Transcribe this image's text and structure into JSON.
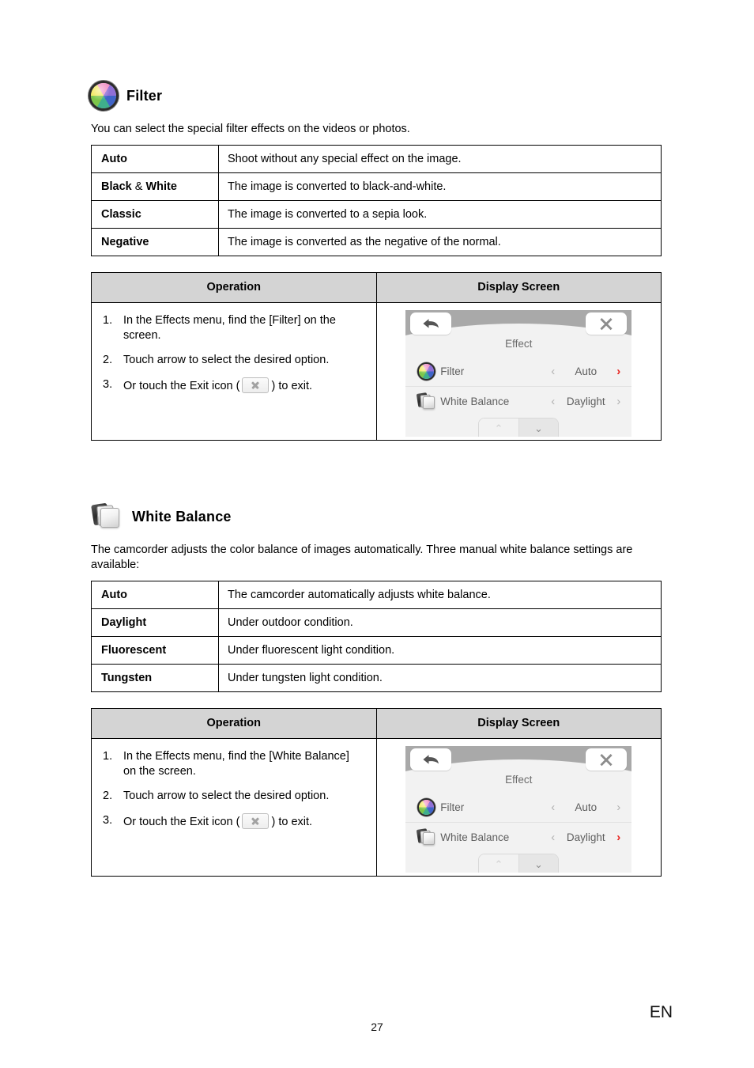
{
  "document": {
    "page_number": "27",
    "language_code": "EN"
  },
  "sections": [
    {
      "id": "filter",
      "icon": "color-wheel-icon",
      "title": "Filter",
      "intro": "You can select the special filter effects on the videos or photos.",
      "terms_table": {
        "rows": [
          {
            "term": "Auto",
            "term_bold_prefix": "Auto",
            "description": "Shoot without any special effect on the image."
          },
          {
            "term": "Black & White",
            "term_bold_prefix": "Black",
            "term_amp": "&",
            "term_bold_suffix": "White",
            "description": "The image is converted to black-and-white."
          },
          {
            "term": "Classic",
            "description": "The image is converted to a sepia look."
          },
          {
            "term": "Negative",
            "description": "The image is converted as the negative of the normal."
          }
        ]
      },
      "operation_table": {
        "headers": {
          "operation": "Operation",
          "display_screen": "Display Screen"
        },
        "steps": [
          {
            "num": "1.",
            "text": "In the Effects menu, find the [Filter] on the screen."
          },
          {
            "num": "2.",
            "text": "Touch arrow to select the desired option."
          },
          {
            "num": "3.",
            "text_before": "Or touch the Exit icon (",
            "icon": "exit-icon",
            "text_after": ") to exit."
          }
        ],
        "screen": {
          "back_icon": "back-arrow-icon",
          "close_icon": "close-x-icon",
          "title": "Effect",
          "rows": [
            {
              "icon": "color-wheel-icon",
              "label": "Filter",
              "left_chevron": "‹",
              "value": "Auto",
              "right_chevron": "›",
              "right_highlighted": true
            },
            {
              "icon": "card-stack-icon",
              "label": "White Balance",
              "left_chevron": "‹",
              "value": "Daylight",
              "right_chevron": "›",
              "right_highlighted": false
            }
          ],
          "pager": {
            "up": "⌃",
            "down": "⌄"
          }
        }
      }
    },
    {
      "id": "white-balance",
      "icon": "card-stack-icon",
      "title": "White Balance",
      "intro": "The camcorder adjusts the color balance of images automatically. Three manual white balance settings are available:",
      "terms_table": {
        "rows": [
          {
            "term": "Auto",
            "description": "The camcorder automatically adjusts white balance."
          },
          {
            "term": "Daylight",
            "description": "Under outdoor condition."
          },
          {
            "term": "Fluorescent",
            "description": "Under fluorescent light condition."
          },
          {
            "term": "Tungsten",
            "description": "Under tungsten light condition."
          }
        ]
      },
      "operation_table": {
        "headers": {
          "operation": "Operation",
          "display_screen": "Display Screen"
        },
        "steps": [
          {
            "num": "1.",
            "text": "In the Effects menu, find the [White Balance] on the screen."
          },
          {
            "num": "2.",
            "text": "Touch arrow to select the desired option."
          },
          {
            "num": "3.",
            "text_before": "Or touch the Exit icon (",
            "icon": "exit-icon",
            "text_after": ") to exit."
          }
        ],
        "screen": {
          "back_icon": "back-arrow-icon",
          "close_icon": "close-x-icon",
          "title": "Effect",
          "rows": [
            {
              "icon": "color-wheel-icon",
              "label": "Filter",
              "left_chevron": "‹",
              "value": "Auto",
              "right_chevron": "›",
              "right_highlighted": false
            },
            {
              "icon": "card-stack-icon",
              "label": "White Balance",
              "left_chevron": "‹",
              "value": "Daylight",
              "right_chevron": "›",
              "right_highlighted": true
            }
          ],
          "pager": {
            "up": "⌃",
            "down": "⌄"
          }
        }
      }
    }
  ],
  "colors": {
    "highlight_red": "#e8231f",
    "header_gray": "#d4d4d4",
    "screen_bg": "#f2f2f2",
    "topbar_gray": "#a9a9a9"
  }
}
